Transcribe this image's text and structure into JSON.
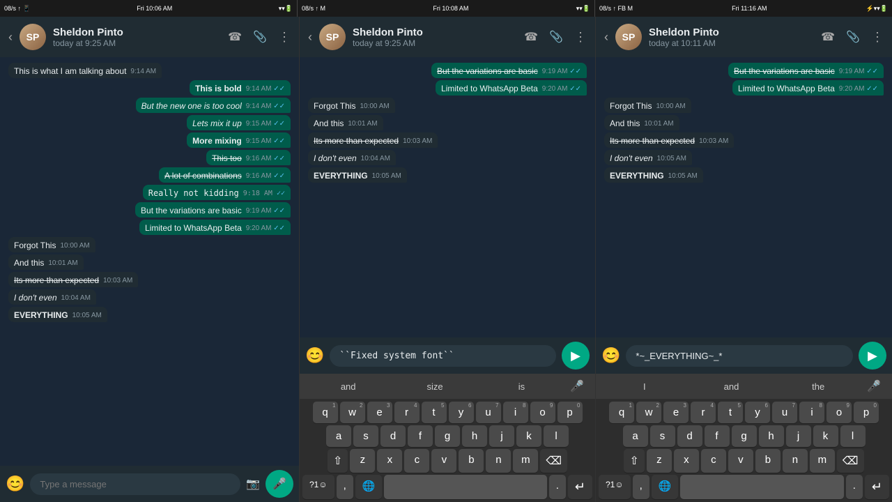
{
  "statusBars": [
    {
      "left": "08/s ↑ 📱",
      "time": "Fri 10:06 AM",
      "right": "📶 🔋"
    },
    {
      "left": "08/s ↑ M",
      "time": "Fri 10:08 AM",
      "right": "📶 🔋"
    },
    {
      "left": "08/s ↑ FB M",
      "time": "Fri 11:16 AM",
      "right": "📶 🔋 ⚡"
    }
  ],
  "panels": [
    {
      "id": "panel-left",
      "header": {
        "name": "Sheldon Pinto",
        "sub": "today at 9:25 AM"
      },
      "messages": [
        {
          "type": "received",
          "text": "This is what I am talking about",
          "time": "9:14 AM",
          "checked": true
        },
        {
          "type": "sent",
          "text": "This is bold",
          "bold": true,
          "time": "9:14 AM",
          "checked": true
        },
        {
          "type": "sent",
          "text": "But the new one is too cool",
          "italic": true,
          "time": "9:14 AM",
          "checked": true
        },
        {
          "type": "sent",
          "text": "Lets mix it up",
          "mixed": true,
          "time": "9:15 AM",
          "checked": true
        },
        {
          "type": "sent",
          "text": "More mixing",
          "bold": true,
          "time": "9:15 AM",
          "checked": true
        },
        {
          "type": "sent",
          "text": "This too",
          "strike": true,
          "time": "9:16 AM",
          "checked": true
        },
        {
          "type": "sent",
          "text": "A lot of combinations",
          "strike": true,
          "time": "9:16 AM",
          "checked": true
        },
        {
          "type": "sent",
          "text": "Really not kidding",
          "mono": true,
          "time": "9:18 AM",
          "checked": true
        },
        {
          "type": "sent",
          "text": "But the variations are basic",
          "time": "9:19 AM",
          "checked": true
        },
        {
          "type": "sent",
          "text": "Limited to WhatsApp Beta",
          "time": "9:20 AM",
          "checked": true
        },
        {
          "type": "received",
          "text": "Forgot This",
          "time": "10:00 AM",
          "checked": false
        },
        {
          "type": "received",
          "text": "And this",
          "time": "10:01 AM",
          "checked": false
        },
        {
          "type": "received",
          "text": "Its more than expected",
          "strike": true,
          "time": "10:03 AM",
          "checked": false
        },
        {
          "type": "received",
          "text": "I don't even",
          "italic": true,
          "time": "10:04 AM",
          "checked": false
        },
        {
          "type": "received",
          "text": "EVERYTHING",
          "bold": true,
          "time": "10:05 AM",
          "checked": false
        }
      ],
      "input": {
        "placeholder": "Type a message",
        "value": ""
      }
    },
    {
      "id": "panel-mid",
      "header": {
        "name": "Sheldon Pinto",
        "sub": "today at 9:25 AM"
      },
      "messages": [
        {
          "type": "sent",
          "text": "But the variations are basic",
          "strike": true,
          "time": "9:19 AM",
          "checked": true
        },
        {
          "type": "sent",
          "text": "Limited to WhatsApp Beta",
          "time": "9:20 AM",
          "checked": true
        },
        {
          "type": "received",
          "text": "Forgot This",
          "time": "10:00 AM",
          "checked": false
        },
        {
          "type": "received",
          "text": "And this",
          "time": "10:01 AM",
          "checked": false
        },
        {
          "type": "received",
          "text": "Its more than expected",
          "strike": true,
          "time": "10:03 AM",
          "checked": false
        },
        {
          "type": "received",
          "text": "I don't even",
          "italic": true,
          "time": "10:04 AM",
          "checked": false
        },
        {
          "type": "received",
          "text": "EVERYTHING",
          "bold": true,
          "time": "10:05 AM",
          "checked": false
        }
      ],
      "input": {
        "placeholder": "``Fixed system font``",
        "value": "``Fixed system font``"
      }
    },
    {
      "id": "panel-right",
      "header": {
        "name": "Sheldon Pinto",
        "sub": "today at 10:11 AM"
      },
      "messages": [
        {
          "type": "sent",
          "text": "But the variations are basic",
          "strike": true,
          "time": "9:19 AM",
          "checked": true
        },
        {
          "type": "sent",
          "text": "Limited to WhatsApp Beta",
          "time": "9:20 AM",
          "checked": true
        },
        {
          "type": "received",
          "text": "Forgot This",
          "time": "10:00 AM",
          "checked": false
        },
        {
          "type": "received",
          "text": "And this",
          "time": "10:01 AM",
          "checked": false
        },
        {
          "type": "received",
          "text": "Its more than expected",
          "strike": true,
          "time": "10:03 AM",
          "checked": false
        },
        {
          "type": "received",
          "text": "I don't even",
          "italic": true,
          "time": "10:05 AM",
          "checked": false
        },
        {
          "type": "received",
          "text": "EVERYTHING",
          "bold": true,
          "time": "10:05 AM",
          "checked": false
        }
      ],
      "input": {
        "placeholder": "",
        "value": "*~_EVERYTHING~_*"
      }
    }
  ],
  "keyboard": {
    "suggestions_left": [
      "and",
      "size",
      "is"
    ],
    "suggestions_right": [
      "I",
      "and",
      "the"
    ],
    "rows": [
      [
        "q",
        "w",
        "e",
        "r",
        "t",
        "y",
        "u",
        "i",
        "o",
        "p"
      ],
      [
        "a",
        "s",
        "d",
        "f",
        "g",
        "h",
        "j",
        "k",
        "l"
      ],
      [
        "z",
        "x",
        "c",
        "v",
        "b",
        "n",
        "m"
      ]
    ],
    "numbers": [
      "1",
      "2",
      "3",
      "4",
      "5",
      "6",
      "7",
      "8",
      "9",
      "0"
    ],
    "bottom_left": "?1☺",
    "bottom_right": "?1☺",
    "comma": ",",
    "period": ".",
    "globe": "🌐"
  }
}
